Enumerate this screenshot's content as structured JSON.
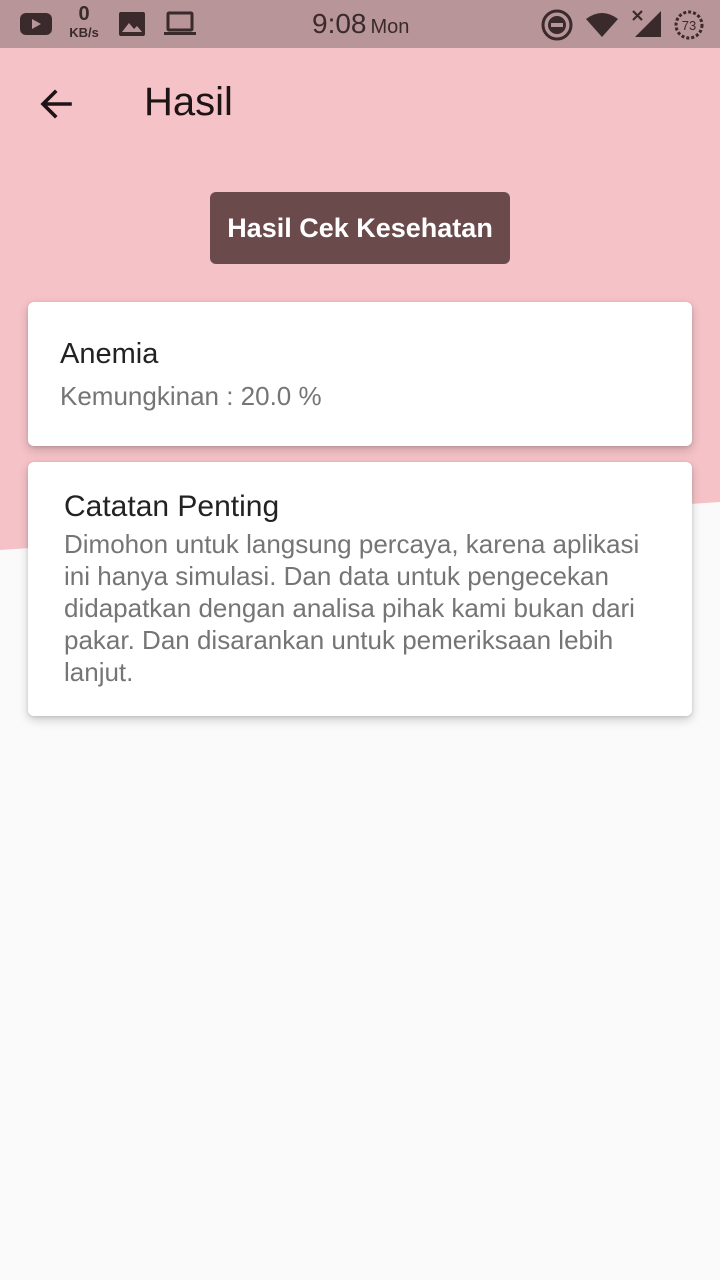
{
  "status_bar": {
    "speed_value": "0",
    "speed_unit": "KB/s",
    "time": "9:08",
    "day": "Mon",
    "battery": "73",
    "icons": [
      "youtube-icon",
      "image-icon",
      "laptop-icon",
      "do-not-disturb-icon",
      "wifi-icon",
      "signal-icon",
      "battery-icon"
    ]
  },
  "app_bar": {
    "back_icon": "arrow-left-icon",
    "title": "Hasil"
  },
  "header_button": {
    "label": "Hasil Cek Kesehatan"
  },
  "result_card": {
    "title": "Anemia",
    "subtitle": "Kemungkinan : 20.0 %"
  },
  "note_card": {
    "title": "Catatan Penting",
    "body": "Dimohon untuk langsung percaya, karena aplikasi ini hanya simulasi. Dan data untuk pengecekan didapatkan dengan analisa pihak kami bukan dari pakar. Dan disarankan untuk pemeriksaan lebih lanjut."
  },
  "colors": {
    "status_bar": "#b79599",
    "header_bg": "#f4c2c7",
    "button": "#6b4a4c",
    "page_bg": "#fafafa"
  }
}
